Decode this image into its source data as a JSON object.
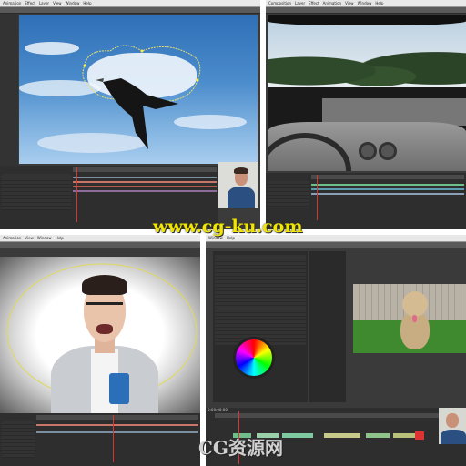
{
  "quad_tl": {
    "menu": [
      "Animation",
      "Effect",
      "Layer",
      "View",
      "Window",
      "Help"
    ]
  },
  "quad_tr": {
    "menu": [
      "Composition",
      "Layer",
      "Effect",
      "Animation",
      "View",
      "Window",
      "Help"
    ]
  },
  "quad_bl": {
    "menu": [
      "Animation",
      "View",
      "Window",
      "Help"
    ]
  },
  "quad_br": {
    "menu": [
      "Window",
      "Help"
    ],
    "tc": "0:00:00:00"
  },
  "watermark": {
    "text": "www.cg-ku.com",
    "logo_text": "CG资源网"
  },
  "colors": {
    "panel": "#2e2e2e",
    "accent_track": "#c9766a",
    "green_track": "#6fbf8a",
    "watermark": "#f2e600"
  }
}
